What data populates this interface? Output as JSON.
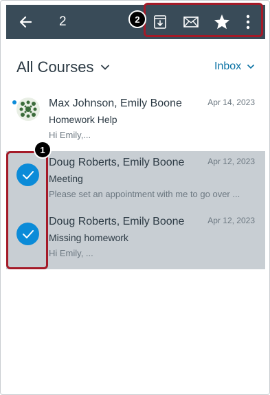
{
  "toolbar": {
    "selected_count": "2",
    "actions": [
      {
        "icon": "archive-icon"
      },
      {
        "icon": "mark-unread-icon"
      },
      {
        "icon": "star-icon"
      },
      {
        "icon": "more-options-icon"
      }
    ]
  },
  "callouts": {
    "actions_badge": "2",
    "selection_badge": "1",
    "highlight_color": "#a41a28"
  },
  "header": {
    "course_filter": "All Courses",
    "mailbox": "Inbox"
  },
  "messages": [
    {
      "sender": "Max Johnson, Emily Boone",
      "subject": "Homework Help",
      "preview": "Hi Emily,...",
      "date": "Apr 14, 2023",
      "unread": true,
      "selected": false
    },
    {
      "sender": "Doug Roberts, Emily Boone",
      "subject": "Meeting",
      "preview": "Please set an appointment with me to go over ...",
      "date": "Apr 12, 2023",
      "unread": false,
      "selected": true
    },
    {
      "sender": "Doug Roberts, Emily Boone",
      "subject": "Missing homework",
      "preview": "Hi Emily, ...",
      "date": "Apr 12, 2023",
      "unread": false,
      "selected": true
    }
  ],
  "colors": {
    "toolbar_bg": "#394b58",
    "selected_row_bg": "#c8ced3",
    "accent_blue": "#0b8bd8",
    "link_blue": "#0770a3"
  }
}
